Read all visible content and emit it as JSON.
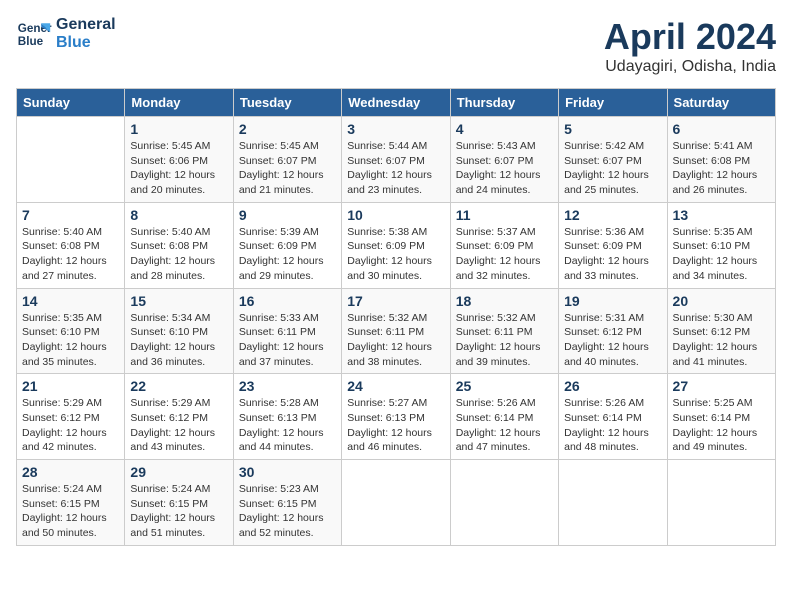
{
  "logo": {
    "line1": "General",
    "line2": "Blue"
  },
  "title": "April 2024",
  "subtitle": "Udayagiri, Odisha, India",
  "weekdays": [
    "Sunday",
    "Monday",
    "Tuesday",
    "Wednesday",
    "Thursday",
    "Friday",
    "Saturday"
  ],
  "weeks": [
    [
      {
        "day": "",
        "info": ""
      },
      {
        "day": "1",
        "info": "Sunrise: 5:45 AM\nSunset: 6:06 PM\nDaylight: 12 hours\nand 20 minutes."
      },
      {
        "day": "2",
        "info": "Sunrise: 5:45 AM\nSunset: 6:07 PM\nDaylight: 12 hours\nand 21 minutes."
      },
      {
        "day": "3",
        "info": "Sunrise: 5:44 AM\nSunset: 6:07 PM\nDaylight: 12 hours\nand 23 minutes."
      },
      {
        "day": "4",
        "info": "Sunrise: 5:43 AM\nSunset: 6:07 PM\nDaylight: 12 hours\nand 24 minutes."
      },
      {
        "day": "5",
        "info": "Sunrise: 5:42 AM\nSunset: 6:07 PM\nDaylight: 12 hours\nand 25 minutes."
      },
      {
        "day": "6",
        "info": "Sunrise: 5:41 AM\nSunset: 6:08 PM\nDaylight: 12 hours\nand 26 minutes."
      }
    ],
    [
      {
        "day": "7",
        "info": "Sunrise: 5:40 AM\nSunset: 6:08 PM\nDaylight: 12 hours\nand 27 minutes."
      },
      {
        "day": "8",
        "info": "Sunrise: 5:40 AM\nSunset: 6:08 PM\nDaylight: 12 hours\nand 28 minutes."
      },
      {
        "day": "9",
        "info": "Sunrise: 5:39 AM\nSunset: 6:09 PM\nDaylight: 12 hours\nand 29 minutes."
      },
      {
        "day": "10",
        "info": "Sunrise: 5:38 AM\nSunset: 6:09 PM\nDaylight: 12 hours\nand 30 minutes."
      },
      {
        "day": "11",
        "info": "Sunrise: 5:37 AM\nSunset: 6:09 PM\nDaylight: 12 hours\nand 32 minutes."
      },
      {
        "day": "12",
        "info": "Sunrise: 5:36 AM\nSunset: 6:09 PM\nDaylight: 12 hours\nand 33 minutes."
      },
      {
        "day": "13",
        "info": "Sunrise: 5:35 AM\nSunset: 6:10 PM\nDaylight: 12 hours\nand 34 minutes."
      }
    ],
    [
      {
        "day": "14",
        "info": "Sunrise: 5:35 AM\nSunset: 6:10 PM\nDaylight: 12 hours\nand 35 minutes."
      },
      {
        "day": "15",
        "info": "Sunrise: 5:34 AM\nSunset: 6:10 PM\nDaylight: 12 hours\nand 36 minutes."
      },
      {
        "day": "16",
        "info": "Sunrise: 5:33 AM\nSunset: 6:11 PM\nDaylight: 12 hours\nand 37 minutes."
      },
      {
        "day": "17",
        "info": "Sunrise: 5:32 AM\nSunset: 6:11 PM\nDaylight: 12 hours\nand 38 minutes."
      },
      {
        "day": "18",
        "info": "Sunrise: 5:32 AM\nSunset: 6:11 PM\nDaylight: 12 hours\nand 39 minutes."
      },
      {
        "day": "19",
        "info": "Sunrise: 5:31 AM\nSunset: 6:12 PM\nDaylight: 12 hours\nand 40 minutes."
      },
      {
        "day": "20",
        "info": "Sunrise: 5:30 AM\nSunset: 6:12 PM\nDaylight: 12 hours\nand 41 minutes."
      }
    ],
    [
      {
        "day": "21",
        "info": "Sunrise: 5:29 AM\nSunset: 6:12 PM\nDaylight: 12 hours\nand 42 minutes."
      },
      {
        "day": "22",
        "info": "Sunrise: 5:29 AM\nSunset: 6:12 PM\nDaylight: 12 hours\nand 43 minutes."
      },
      {
        "day": "23",
        "info": "Sunrise: 5:28 AM\nSunset: 6:13 PM\nDaylight: 12 hours\nand 44 minutes."
      },
      {
        "day": "24",
        "info": "Sunrise: 5:27 AM\nSunset: 6:13 PM\nDaylight: 12 hours\nand 46 minutes."
      },
      {
        "day": "25",
        "info": "Sunrise: 5:26 AM\nSunset: 6:14 PM\nDaylight: 12 hours\nand 47 minutes."
      },
      {
        "day": "26",
        "info": "Sunrise: 5:26 AM\nSunset: 6:14 PM\nDaylight: 12 hours\nand 48 minutes."
      },
      {
        "day": "27",
        "info": "Sunrise: 5:25 AM\nSunset: 6:14 PM\nDaylight: 12 hours\nand 49 minutes."
      }
    ],
    [
      {
        "day": "28",
        "info": "Sunrise: 5:24 AM\nSunset: 6:15 PM\nDaylight: 12 hours\nand 50 minutes."
      },
      {
        "day": "29",
        "info": "Sunrise: 5:24 AM\nSunset: 6:15 PM\nDaylight: 12 hours\nand 51 minutes."
      },
      {
        "day": "30",
        "info": "Sunrise: 5:23 AM\nSunset: 6:15 PM\nDaylight: 12 hours\nand 52 minutes."
      },
      {
        "day": "",
        "info": ""
      },
      {
        "day": "",
        "info": ""
      },
      {
        "day": "",
        "info": ""
      },
      {
        "day": "",
        "info": ""
      }
    ]
  ]
}
